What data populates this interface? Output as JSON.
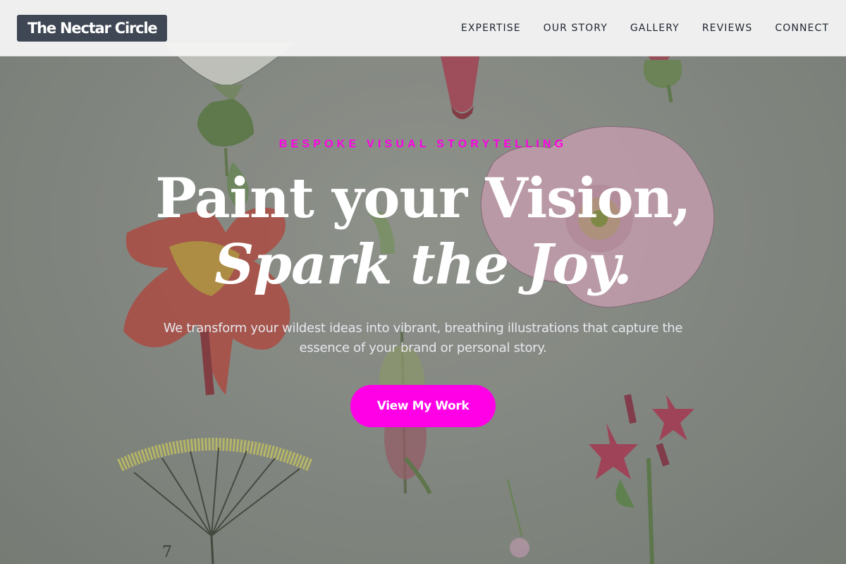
{
  "brand": {
    "logo_text": "The Nectar Circle"
  },
  "nav": {
    "items": [
      {
        "label": "EXPERTISE"
      },
      {
        "label": "OUR STORY"
      },
      {
        "label": "GALLERY"
      },
      {
        "label": "REVIEWS"
      },
      {
        "label": "CONNECT"
      }
    ]
  },
  "hero": {
    "eyebrow": "BESPOKE VISUAL STORYTELLING",
    "headline_line1": "Paint your Vision,",
    "headline_line2": "Spark the Joy.",
    "subtext": "We transform your wildest ideas into vibrant, breathing illustrations that capture the essence of your brand or personal story.",
    "cta_label": "View My Work"
  },
  "colors": {
    "accent": "#ff00e6",
    "brand_bg": "#3f4755",
    "nav_bg": "#f4f4f4",
    "nav_text": "#1f2430",
    "background": "#8d918b",
    "headline": "#ffffff"
  }
}
